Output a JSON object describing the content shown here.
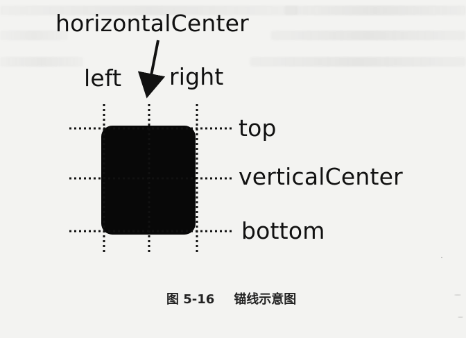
{
  "diagram": {
    "labels": {
      "horizontal_center": "horizontalCenter",
      "left": "left",
      "right": "right",
      "top": "top",
      "vertical_center": "verticalCenter",
      "bottom": "bottom"
    },
    "caption": {
      "figure_number": "图 5-16",
      "title": "锚线示意图"
    },
    "colors": {
      "box": "#080808",
      "lines": "#111111",
      "background": "#f3f3f1"
    }
  }
}
